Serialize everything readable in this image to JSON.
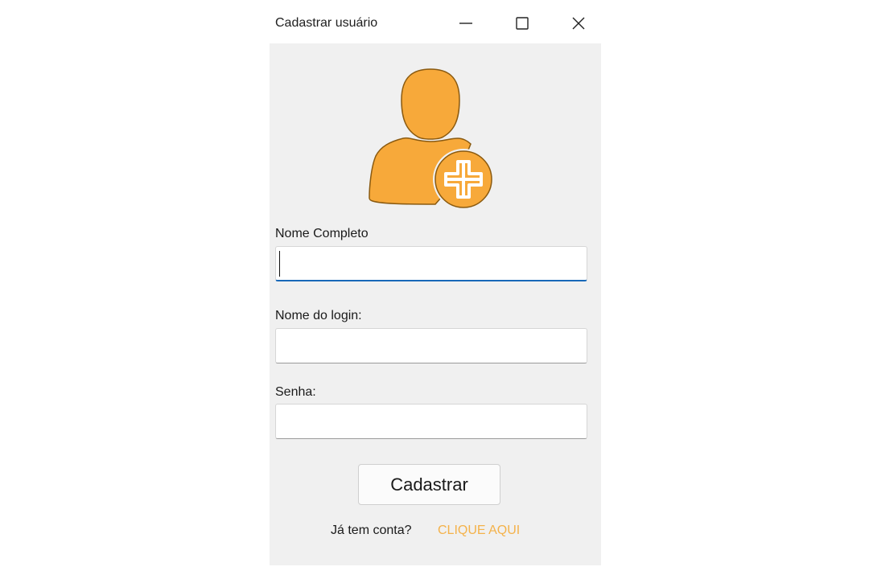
{
  "window": {
    "title": "Cadastrar usuário"
  },
  "titlebar_buttons": {
    "minimize_icon": "minimize-icon",
    "maximize_icon": "maximize-icon",
    "close_icon": "close-icon"
  },
  "avatar": {
    "icon": "add-user-icon",
    "color": "#F7A93A",
    "outline": "#8a5a10"
  },
  "form": {
    "full_name_label": "Nome Completo",
    "full_name_value": "",
    "login_label": "Nome do login:",
    "login_value": "",
    "password_label": "Senha:",
    "password_value": "",
    "submit_label": "Cadastrar"
  },
  "footer": {
    "have_account_text": "Já tem conta?",
    "login_link_text": "CLIQUE AQUI",
    "link_color": "#F4B24A"
  }
}
